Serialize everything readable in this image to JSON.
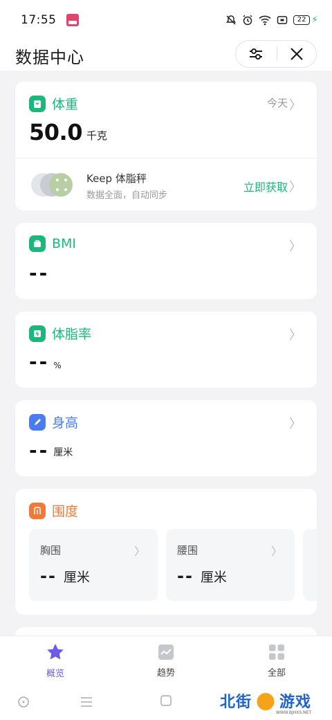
{
  "status_bar": {
    "time": "17:55",
    "battery": "22"
  },
  "header": {
    "title": "数据中心"
  },
  "weight": {
    "title": "体重",
    "date": "今天",
    "value": "50.0",
    "unit": "千克",
    "scale": {
      "name": "Keep 体脂秤",
      "desc": "数据全面，自动同步",
      "action": "立即获取"
    }
  },
  "bmi": {
    "title": "BMI",
    "value": "--"
  },
  "body_fat": {
    "title": "体脂率",
    "value": "--",
    "unit": "%"
  },
  "height": {
    "title": "身高",
    "value": "--",
    "unit": "厘米"
  },
  "girth": {
    "title": "围度",
    "items": [
      {
        "label": "胸围",
        "value": "--",
        "unit": "厘米"
      },
      {
        "label": "腰围",
        "value": "--",
        "unit": "厘米"
      }
    ]
  },
  "bottom_nav": {
    "items": [
      {
        "label": "概览",
        "active": true
      },
      {
        "label": "趋势",
        "active": false
      },
      {
        "label": "全部",
        "active": false
      }
    ]
  },
  "watermark": {
    "left": "北街",
    "right": "游戏",
    "sub": "WWW.BJHXS.NET"
  },
  "colors": {
    "green": "#1cb77a",
    "blue": "#4a7cf0",
    "orange": "#f07a3a",
    "purple": "#6c5ce7"
  }
}
